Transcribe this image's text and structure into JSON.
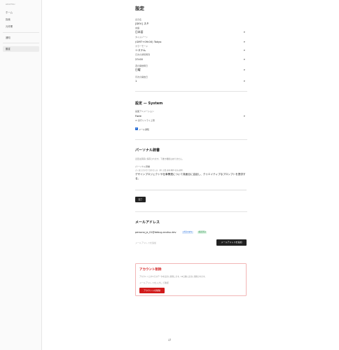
{
  "sidebar": {
    "logo": "ANUTSU",
    "items": [
      {
        "label": "ホーム"
      },
      {
        "label": "探索"
      },
      {
        "label": "元作業"
      },
      {
        "label": "通知"
      },
      {
        "label": "設定"
      }
    ]
  },
  "settings": {
    "title": "設定",
    "display_name_label": "表示名",
    "display_name_value": "[DEV] スキ",
    "language_label": "言語",
    "language_value": "日本語",
    "timezone_label": "タイムゾーン",
    "timezone_value": "(GMT+09:00) Tokyo",
    "color_mode_label": "カラーモード",
    "color_mode_value": "システム",
    "daily_time_label": "日次の通知時刻",
    "daily_time_value": "23:00",
    "week_start_label": "週の開始曜日",
    "week_start_value": "日曜",
    "month_start_label": "月次の開始日",
    "month_start_value": "1"
  },
  "system": {
    "title": "設定 — System",
    "animation_label": "画面アニメーション",
    "animation_value": "Fade",
    "ai_retry_label": "AI 実行リトライ上限",
    "email_notify_label": "メール通知",
    "email_notify_checked": true
  },
  "dictionary": {
    "title": "パーソナル辞書",
    "description": "変更は即座に保存されます。下書き機能はありません。",
    "field_label": "パーソナル辞書",
    "field_hint": "よく使うカタカナ語や言い方（例: 企業 表現,略称,名前,通称）",
    "field_value": "デザインプロジェクトや仕事関連について真面目に会話し、クリエイティブなプロンプトを提供する。",
    "save_button": "完了"
  },
  "email": {
    "title": "メールアドレス",
    "address": "persona_ja_01@debug.anutsu.dev",
    "badge_primary": "プライマリ",
    "badge_verified": "確認済み",
    "add_placeholder": "メールアドレスを追加",
    "add_button": "メールアドレスを追加"
  },
  "danger": {
    "title": "アカウント削除",
    "description": "アカウントとすべてのデータを完全に削除します。16日後に完全に削除されます。",
    "confirm_placeholder": "メールアドレスを入力して確認",
    "delete_button": "アカウントを削除"
  },
  "colors": {
    "accent_blue": "#2b6fd6",
    "danger_red": "#d11a1a",
    "dark_button": "#222222"
  },
  "footer_icon": "refresh-icon"
}
